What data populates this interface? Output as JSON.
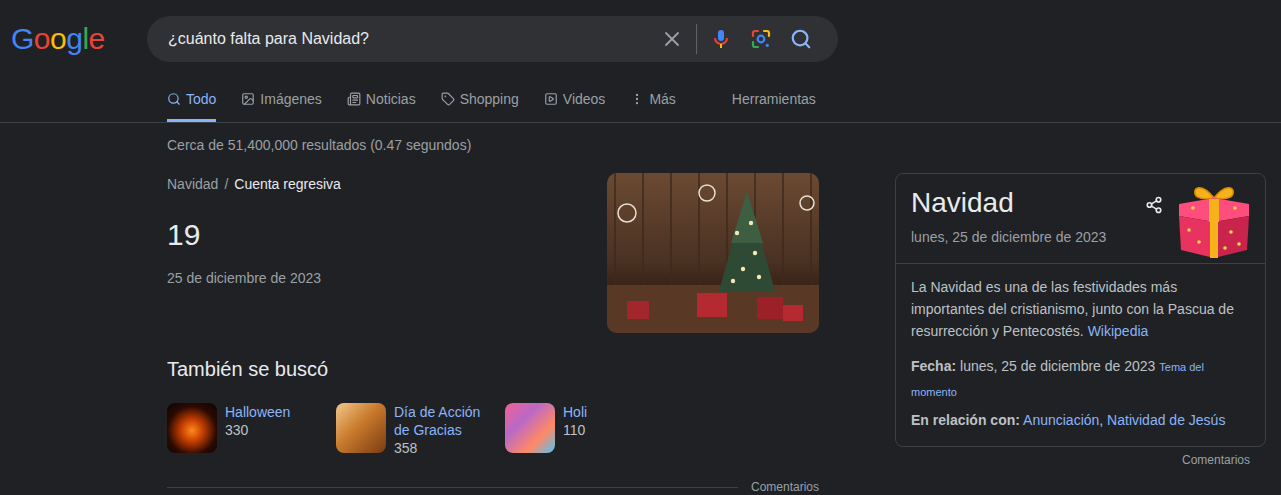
{
  "logo": "Google",
  "search": {
    "query": "¿cuánto falta para Navidad?"
  },
  "tabs": [
    {
      "label": "Todo",
      "selected": true
    },
    {
      "label": "Imágenes",
      "selected": false
    },
    {
      "label": "Noticias",
      "selected": false
    },
    {
      "label": "Shopping",
      "selected": false
    },
    {
      "label": "Videos",
      "selected": false
    },
    {
      "label": "Más",
      "selected": false
    }
  ],
  "tools": "Herramientas",
  "stats": "Cerca de 51,400,000 resultados (0.47 segundos)",
  "countdown": {
    "breadcrumb": [
      "Navidad",
      "Cuenta regresiva"
    ],
    "separator": "/",
    "days": "19",
    "date": "25 de diciembre de 2023"
  },
  "related": {
    "title": "También se buscó",
    "items": [
      {
        "label": "Halloween",
        "count": "330"
      },
      {
        "label": "Día de Acción de Gracias",
        "count": "358"
      },
      {
        "label": "Holi",
        "count": "110"
      }
    ]
  },
  "feedback": "Comentarios",
  "knowledge_panel": {
    "title": "Navidad",
    "subtitle": "lunes, 25 de diciembre de 2023",
    "description": "La Navidad es una de las festividades más importantes del cristianismo, junto con la Pascua de resurrección y Pentecostés.",
    "source": "Wikipedia",
    "date_fact": {
      "label": "Fecha:",
      "value": "lunes, 25 de diciembre de 2023",
      "tag": "Tema del momento"
    },
    "related_fact": {
      "label": "En relación con:",
      "links": [
        "Anunciación",
        "Natividad de Jesús"
      ]
    },
    "feedback": "Comentarios"
  }
}
